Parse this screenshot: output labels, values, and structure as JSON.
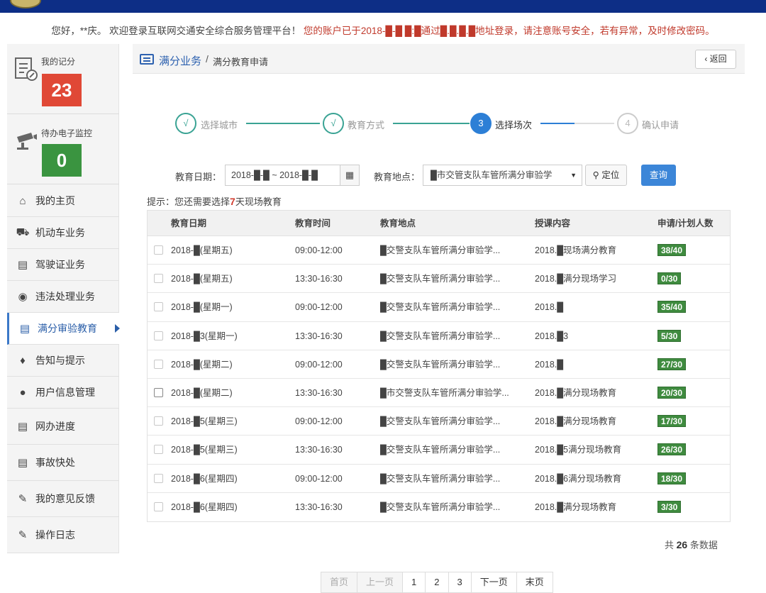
{
  "header": {
    "welcome_hello": "您好，**庆。 欢迎登录互联网交通安全综合服务管理平台！",
    "welcome_warning": "您的账户已于2018-█-█ █:█通过█.█.█.█地址登录，请注意账号安全，若有异常，及时修改密码。"
  },
  "sidebar": {
    "score_label": "我的记分",
    "score_value": "23",
    "monitor_label": "待办电子监控",
    "monitor_value": "0",
    "items": [
      {
        "label": "我的主页",
        "icon": "home-icon"
      },
      {
        "label": "机动车业务",
        "icon": "truck-icon"
      },
      {
        "label": "驾驶证业务",
        "icon": "card-icon"
      },
      {
        "label": "违法处理业务",
        "icon": "camera-icon"
      },
      {
        "label": "满分审验教育",
        "icon": "list-icon"
      },
      {
        "label": "告知与提示",
        "icon": "bell-icon"
      },
      {
        "label": "用户信息管理",
        "icon": "user-icon"
      },
      {
        "label": "网办进度",
        "icon": "progress-icon"
      },
      {
        "label": "事故快处",
        "icon": "accident-icon"
      },
      {
        "label": "我的意见反馈",
        "icon": "feedback-icon"
      },
      {
        "label": "操作日志",
        "icon": "log-icon"
      }
    ]
  },
  "breadcrumb": {
    "section": "满分业务",
    "separator": "/",
    "page": "满分教育申请",
    "back_label": "‹ 返回"
  },
  "steps": [
    {
      "mark": "√",
      "label": "选择城市",
      "state": "done"
    },
    {
      "mark": "√",
      "label": "教育方式",
      "state": "done"
    },
    {
      "mark": "3",
      "label": "选择场次",
      "state": "current"
    },
    {
      "mark": "4",
      "label": "确认申请",
      "state": "todo"
    }
  ],
  "filter": {
    "date_label": "教育日期：",
    "date_value": "2018-█-█ ~ 2018-█-█",
    "place_label": "教育地点：",
    "place_value": "█市交管支队车管所满分审验学",
    "locate_label": "定位",
    "query_label": "查询"
  },
  "hint": {
    "prefix": "提示：您还需要选择",
    "count": "7",
    "suffix": "天现场教育"
  },
  "table": {
    "headers": [
      "教育日期",
      "教育时间",
      "教育地点",
      "授课内容",
      "申请/计划人数"
    ],
    "rows": [
      {
        "date": "2018-█(星期五)",
        "time": "09:00-12:00",
        "place": "█交警支队车管所满分审验学...",
        "content": "2018.█现场满分教育",
        "count": "38/40"
      },
      {
        "date": "2018-█(星期五)",
        "time": "13:30-16:30",
        "place": "█交警支队车管所满分审验学...",
        "content": "2018.█满分现场学习",
        "count": "0/30"
      },
      {
        "date": "2018-█(星期一)",
        "time": "09:00-12:00",
        "place": "█交警支队车管所满分审验学...",
        "content": "2018.█",
        "count": "35/40"
      },
      {
        "date": "2018-█3(星期一)",
        "time": "13:30-16:30",
        "place": "█交警支队车管所满分审验学...",
        "content": "2018.█3",
        "count": "5/30"
      },
      {
        "date": "2018-█(星期二)",
        "time": "09:00-12:00",
        "place": "█交警支队车管所满分审验学...",
        "content": "2018.█",
        "count": "27/30"
      },
      {
        "date": "2018-█(星期二)",
        "time": "13:30-16:30",
        "place": "█市交警支队车管所满分审验学...",
        "content": "2018.█满分现场教育",
        "count": "20/30"
      },
      {
        "date": "2018-█5(星期三)",
        "time": "09:00-12:00",
        "place": "█交警支队车管所满分审验学...",
        "content": "2018.█满分现场教育",
        "count": "17/30"
      },
      {
        "date": "2018-█5(星期三)",
        "time": "13:30-16:30",
        "place": "█交警支队车管所满分审验学...",
        "content": "2018.█5满分现场教育",
        "count": "26/30"
      },
      {
        "date": "2018-█6(星期四)",
        "time": "09:00-12:00",
        "place": "█交警支队车管所满分审验学...",
        "content": "2018.█6满分现场教育",
        "count": "18/30"
      },
      {
        "date": "2018-█6(星期四)",
        "time": "13:30-16:30",
        "place": "█交警支队车管所满分审验学...",
        "content": "2018.█满分现场教育",
        "count": "3/30"
      }
    ]
  },
  "total": {
    "prefix": "共",
    "count": "26",
    "suffix": "条数据"
  },
  "pager": {
    "first": "首页",
    "prev": "上一页",
    "pages": [
      "1",
      "2",
      "3"
    ],
    "next": "下一页",
    "last": "末页"
  },
  "colors": {
    "topbar": "#0d2e86",
    "accent": "#2d7fd6",
    "step_done": "#3aa394",
    "score_red": "#e04836",
    "badge_green": "#3f8b3f"
  }
}
